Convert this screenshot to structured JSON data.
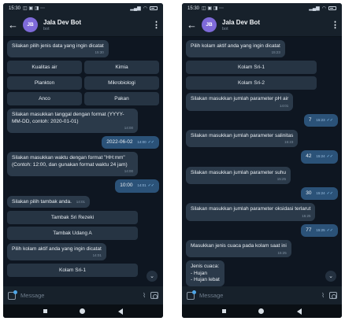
{
  "status": {
    "time": "15:30"
  },
  "header": {
    "avatar": "JB",
    "title": "Jala Dev Bot",
    "subtitle": "bot"
  },
  "composer": {
    "placeholder": "Message"
  },
  "left": {
    "m1": {
      "text": "Silakan pilih jenis data yang ingin dicatat",
      "time": "15:30"
    },
    "k1": [
      "Kualitas air",
      "Kimia",
      "Plankton",
      "Mikrobiologi",
      "Anco",
      "Pakan"
    ],
    "m2": {
      "text": "Silakan masukkan tanggal dengan format (YYYY-MM-DD, contoh: 2020-01-01)",
      "time": "14:00"
    },
    "o1": {
      "text": "2022-06-02",
      "time": "14:00"
    },
    "m3": {
      "text": "Silakan masukkan waktu dengan format \"HH:mm\" (Contoh: 12:00, dan gunakan format waktu 24 jam)",
      "time": "14:00"
    },
    "o2": {
      "text": "10:00",
      "time": "14:01"
    },
    "m4": {
      "text": "Silakan pilih tambak anda.",
      "time": "14:01"
    },
    "k2": [
      "Tambak Sri Rezeki",
      "Tambak Udang A"
    ],
    "m5": {
      "text": "Pilih kolam aktif anda yang ingin dicatat",
      "time": "14:01"
    },
    "k3": [
      "Kolam Sri-1"
    ]
  },
  "right": {
    "m1": {
      "text": "Pilih kolam aktif anda yang ingin dicatat",
      "time": "15:23"
    },
    "k1": [
      "Kolam Sri-1",
      "Kolam Sri-2"
    ],
    "m2": {
      "text": "Silakan masukkan jumlah parameter pH air",
      "time": "14:01"
    },
    "o1": {
      "text": "7",
      "time": "15:23"
    },
    "m3": {
      "text": "Silakan masukkan jumlah parameter salinitas",
      "time": "15:23"
    },
    "o2": {
      "text": "42",
      "time": "15:24"
    },
    "m4": {
      "text": "Silakan masukkan jumlah parameter suhu",
      "time": "15:25"
    },
    "o3": {
      "text": "30",
      "time": "15:24"
    },
    "m5": {
      "text": "Silakan masukkan jumlah parameter oksidasi terlarut",
      "time": "15:25"
    },
    "o4": {
      "text": "77",
      "time": "15:25"
    },
    "m6": {
      "text": "Masukkan jenis cuaca pada kolam saat ini",
      "time": "15:25"
    },
    "m7": {
      "text": "Jenis cuaca:\n- Hujan\n- Hujan lebat"
    }
  },
  "colors": {
    "background": "#0e1621",
    "header": "#17212b",
    "incoming": "#2b3a4a",
    "outgoing": "#2b5278",
    "avatar": "#7e6ad9"
  }
}
